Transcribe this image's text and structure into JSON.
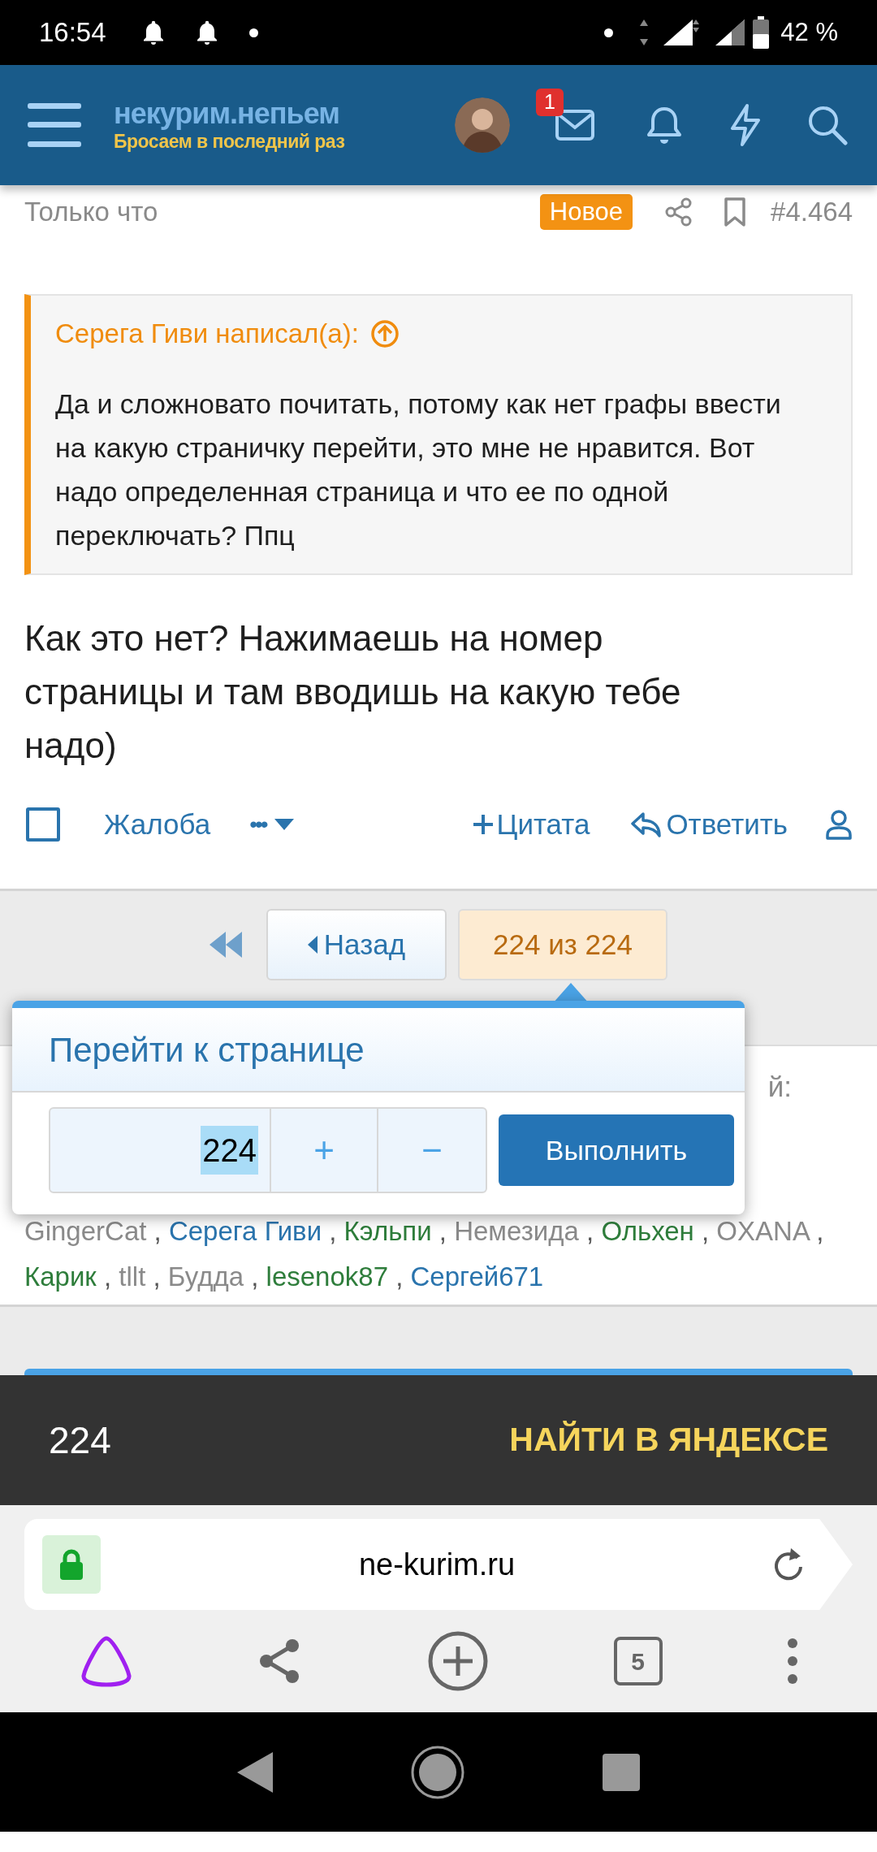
{
  "status_bar": {
    "time": "16:54",
    "battery": "42 %"
  },
  "header": {
    "logo_title": "некурим.непьем",
    "logo_tagline": "Бросаем в последний раз",
    "messages_badge": "1"
  },
  "post": {
    "time": "Только что",
    "badge": "Новое",
    "number": "#4.464",
    "quote": {
      "author": "Серега Гиви написал(а):",
      "text": "Да и сложновато почитать, потому как нет графы ввести на какую страничку перейти, это мне не нравится. Вот надо определенная страница и что ее по одной переключать? Ппц"
    },
    "text": "Как это нет? Нажимаешь на номер страницы и там вводишь на какую тебе надо)",
    "checked": false,
    "actions": [
      {
        "kind": "link",
        "label": "Жалоба"
      },
      {
        "kind": "menu",
        "label": "•••"
      },
      {
        "kind": "quote",
        "label": "Цитата"
      },
      {
        "kind": "reply",
        "label": "Ответить"
      }
    ]
  },
  "pagination": {
    "back": "Назад",
    "current": "224 из 224"
  },
  "page_jump": {
    "title": "Перейти к странице",
    "value": "224",
    "value_selected": true,
    "plus": "+",
    "minus": "−",
    "submit": "Выполнить"
  },
  "reactions": {
    "label_fragment": "й:",
    "separator": ",",
    "users": [
      {
        "name": "GingerCat",
        "color": "#8a8a8a"
      },
      {
        "name": "Серега Гиви",
        "color": "#2a74ad"
      },
      {
        "name": "Кэльпи",
        "color": "#2e7d3b"
      },
      {
        "name": "Немезида",
        "color": "#8a8a8a"
      },
      {
        "name": "Ольхен",
        "color": "#2e7d3b"
      },
      {
        "name": "OXANA",
        "color": "#8a8a8a"
      },
      {
        "name": "Карик",
        "color": "#2e7d3b"
      },
      {
        "name": "tllt",
        "color": "#8a8a8a"
      },
      {
        "name": "Будда",
        "color": "#8a8a8a"
      },
      {
        "name": "lesenok87",
        "color": "#2e7d3b"
      },
      {
        "name": "Сергей671",
        "color": "#2a74ad"
      }
    ]
  },
  "suggestion": {
    "query": "224",
    "action": "НАЙТИ В ЯНДЕКСЕ"
  },
  "address_bar": {
    "url": "ne-kurim.ru"
  },
  "toolbar": {
    "tabs_count": "5"
  }
}
